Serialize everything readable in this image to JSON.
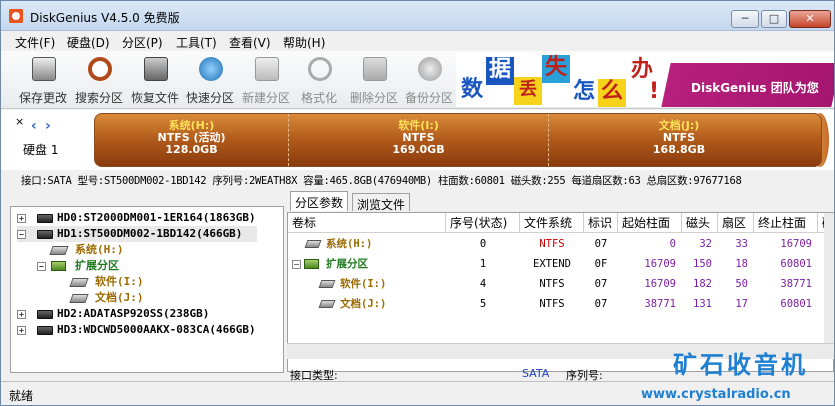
{
  "window": {
    "title": "DiskGenius V4.5.0 免费版",
    "min": "─",
    "max": "□",
    "close": "✕"
  },
  "menu": [
    "文件(F)",
    "硬盘(D)",
    "分区(P)",
    "工具(T)",
    "查看(V)",
    "帮助(H)"
  ],
  "toolbar": [
    {
      "label": "保存更改",
      "icon": "save-icon",
      "enabled": true
    },
    {
      "label": "搜索分区",
      "icon": "search-icon",
      "enabled": true
    },
    {
      "label": "恢复文件",
      "icon": "recover-file-icon",
      "enabled": true
    },
    {
      "label": "快速分区",
      "icon": "quick-partition-icon",
      "enabled": true
    },
    {
      "label": "新建分区",
      "icon": "new-partition-icon",
      "enabled": false
    },
    {
      "label": "格式化",
      "icon": "format-icon",
      "enabled": false
    },
    {
      "label": "删除分区",
      "icon": "delete-partition-icon",
      "enabled": false
    },
    {
      "label": "备份分区",
      "icon": "backup-partition-icon",
      "enabled": false
    }
  ],
  "banner": {
    "chars": [
      "数",
      "据",
      "丢",
      "失",
      "怎",
      "么",
      "办",
      "!"
    ],
    "text": "DiskGenius 团队为您"
  },
  "disk": {
    "label": "硬盘 1",
    "nav_left": "‹",
    "nav_right": "›",
    "partitions": [
      {
        "name": "系统(H:)",
        "fs": "NTFS (活动)",
        "size": "128.0GB"
      },
      {
        "name": "软件(I:)",
        "fs": "NTFS",
        "size": "169.0GB"
      },
      {
        "name": "文档(J:)",
        "fs": "NTFS",
        "size": "168.8GB"
      }
    ]
  },
  "info": "接口:SATA  型号:ST500DM002-1BD142  序列号:2WEATH8X  容量:465.8GB(476940MB)  柱面数:60801  磁头数:255  每道扇区数:63  总扇区数:97677168",
  "tree": [
    {
      "label": "HD0:ST2000DM001-1ER164(1863GB)",
      "exp": "+"
    },
    {
      "label": "HD1:ST500DM002-1BD142(466GB)",
      "exp": "−"
    },
    {
      "label": "系统(H:)"
    },
    {
      "label": "扩展分区",
      "exp": "−"
    },
    {
      "label": "软件(I:)"
    },
    {
      "label": "文档(J:)"
    },
    {
      "label": "HD2:ADATASP920SS(238GB)",
      "exp": "+"
    },
    {
      "label": "HD3:WDCWD5000AAKX-083CA(466GB)",
      "exp": "+"
    }
  ],
  "tabs": [
    "分区参数",
    "浏览文件"
  ],
  "columns": [
    "卷标",
    "序号(状态)",
    "文件系统",
    "标识",
    "起始柱面",
    "磁头",
    "扇区",
    "终止柱面",
    "磁"
  ],
  "rows": [
    {
      "label": "系统(H:)",
      "seq": "0",
      "fs": "NTFS",
      "id": "07",
      "sc": "0",
      "head": "32",
      "sec": "33",
      "ec": "16709"
    },
    {
      "label": "扩展分区",
      "seq": "1",
      "fs": "EXTEND",
      "id": "0F",
      "sc": "16709",
      "head": "150",
      "sec": "18",
      "ec": "60801"
    },
    {
      "label": "软件(I:)",
      "seq": "4",
      "fs": "NTFS",
      "id": "07",
      "sc": "16709",
      "head": "182",
      "sec": "50",
      "ec": "38771"
    },
    {
      "label": "文档(J:)",
      "seq": "5",
      "fs": "NTFS",
      "id": "07",
      "sc": "38771",
      "head": "131",
      "sec": "17",
      "ec": "60801"
    }
  ],
  "iface": {
    "label": "接口类型:",
    "value": "SATA",
    "serial": "序列号:"
  },
  "status": "就绪",
  "watermark": {
    "big": "矿石收音机",
    "url": "www.crystalradio.cn"
  }
}
